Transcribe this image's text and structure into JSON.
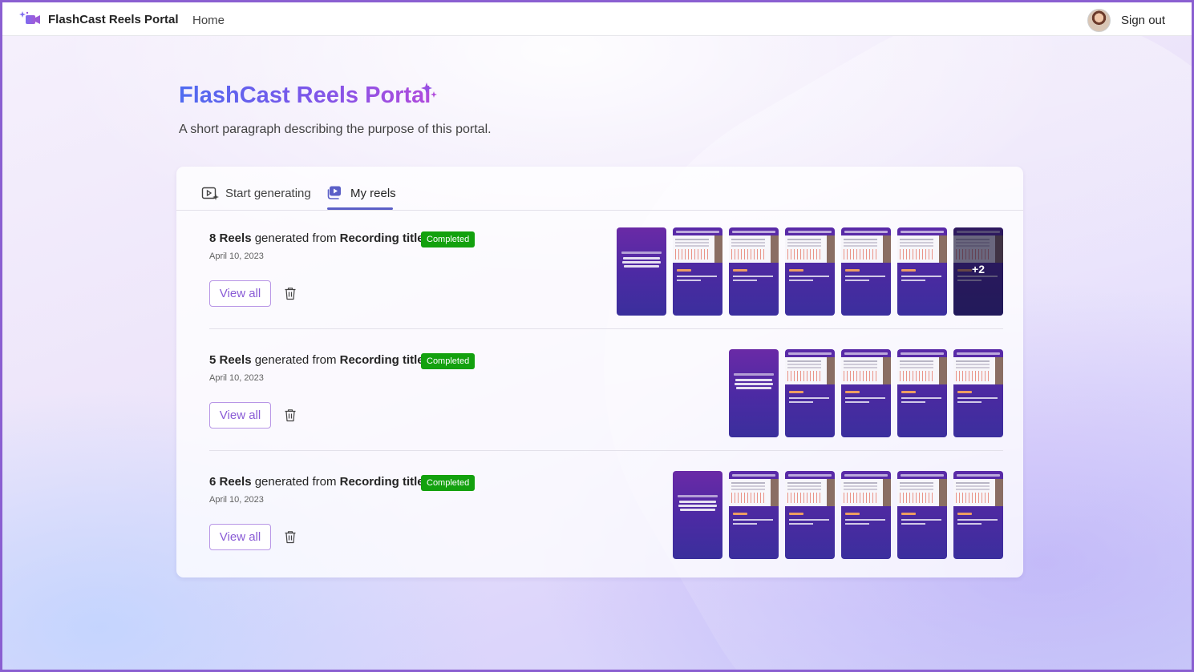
{
  "topbar": {
    "app_name": "FlashCast Reels Portal",
    "nav_home": "Home",
    "sign_out": "Sign out"
  },
  "hero": {
    "title": "FlashCast Reels Portal",
    "description": "A short paragraph describing the purpose of this portal."
  },
  "tabs": {
    "start": "Start generating",
    "reels": "My reels"
  },
  "rows": [
    {
      "count": "8 Reels",
      "middle": " generated from ",
      "recording": "Recording title",
      "status": "Completed",
      "date": "April 10, 2023",
      "view_all": "View all",
      "more": "+2"
    },
    {
      "count": "5 Reels",
      "middle": " generated from ",
      "recording": "Recording title",
      "status": "Completed",
      "date": "April 10, 2023",
      "view_all": "View all"
    },
    {
      "count": "6 Reels",
      "middle": " generated from ",
      "recording": "Recording title",
      "status": "Completed",
      "date": "April 10, 2023",
      "view_all": "View all"
    }
  ],
  "colors": {
    "accent": "#5b5fc7",
    "status_completed": "#13a10e",
    "button_text": "#8a5cd6"
  }
}
